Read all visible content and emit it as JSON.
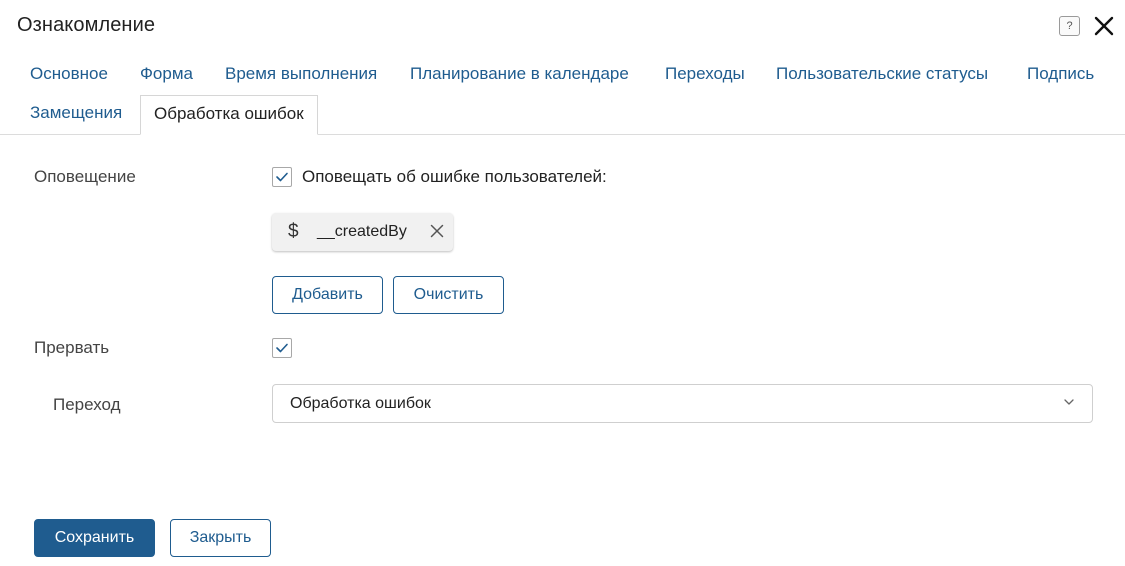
{
  "dialog": {
    "title": "Ознакомление",
    "help_icon_glyph": "?"
  },
  "tabs": [
    {
      "label": "Основное",
      "active": false
    },
    {
      "label": "Форма",
      "active": false
    },
    {
      "label": "Время выполнения",
      "active": false
    },
    {
      "label": "Планирование в календаре",
      "active": false
    },
    {
      "label": "Переходы",
      "active": false
    },
    {
      "label": "Пользовательские статусы",
      "active": false
    },
    {
      "label": "Подпись",
      "active": false
    },
    {
      "label": "Замещения",
      "active": false
    },
    {
      "label": "Обработка ошибок",
      "active": true
    }
  ],
  "notification": {
    "label": "Оповещение",
    "checkbox_label": "Оповещать об ошибке пользователей:",
    "checked": true,
    "chip": {
      "icon": "$",
      "text": "__createdBy"
    },
    "add_label": "Добавить",
    "clear_label": "Очистить"
  },
  "interrupt": {
    "label": "Прервать",
    "checked": true
  },
  "transition": {
    "label": "Переход",
    "value": "Обработка ошибок"
  },
  "footer": {
    "save_label": "Сохранить",
    "close_label": "Закрыть"
  },
  "colors": {
    "accent": "#1f5c8f",
    "text": "#222222",
    "label": "#444444",
    "border": "#cfcfcf"
  }
}
